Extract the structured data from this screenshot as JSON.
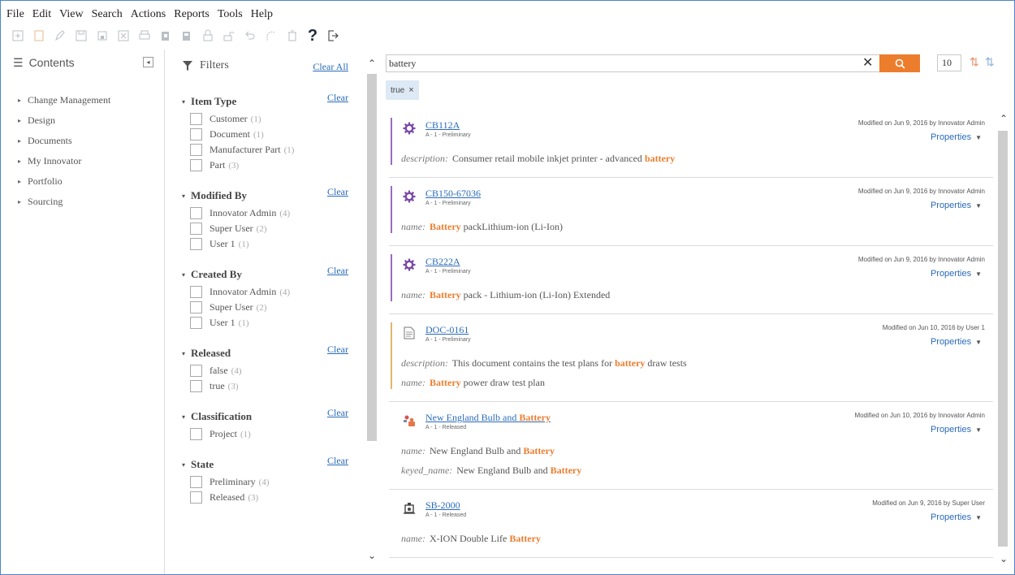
{
  "menu": [
    "File",
    "Edit",
    "View",
    "Search",
    "Actions",
    "Reports",
    "Tools",
    "Help"
  ],
  "toolbar": {
    "icons": [
      "new-icon",
      "open-icon",
      "edit-icon",
      "save-icon",
      "save-close-icon",
      "delete-icon",
      "print-icon",
      "copy-icon",
      "paste-icon",
      "lock-icon",
      "unlock-icon",
      "undo-icon",
      "redo-icon",
      "purge-icon",
      "help-icon",
      "exit-icon"
    ],
    "help_label": "?"
  },
  "contents": {
    "title": "Contents",
    "items": [
      "Change Management",
      "Design",
      "Documents",
      "My Innovator",
      "Portfolio",
      "Sourcing"
    ]
  },
  "filters": {
    "title": "Filters",
    "clear_all": "Clear All",
    "clear": "Clear",
    "groups": [
      {
        "title": "Item Type",
        "options": [
          {
            "label": "Customer",
            "count": "(1)"
          },
          {
            "label": "Document",
            "count": "(1)"
          },
          {
            "label": "Manufacturer Part",
            "count": "(1)"
          },
          {
            "label": "Part",
            "count": "(3)"
          }
        ]
      },
      {
        "title": "Modified By",
        "options": [
          {
            "label": "Innovator Admin",
            "count": "(4)"
          },
          {
            "label": "Super User",
            "count": "(2)"
          },
          {
            "label": "User 1",
            "count": "(1)"
          }
        ]
      },
      {
        "title": "Created By",
        "options": [
          {
            "label": "Innovator Admin",
            "count": "(4)"
          },
          {
            "label": "Super User",
            "count": "(2)"
          },
          {
            "label": "User 1",
            "count": "(1)"
          }
        ]
      },
      {
        "title": "Released",
        "options": [
          {
            "label": "false",
            "count": "(4)"
          },
          {
            "label": "true",
            "count": "(3)"
          }
        ]
      },
      {
        "title": "Classification",
        "options": [
          {
            "label": "Project",
            "count": "(1)"
          }
        ]
      },
      {
        "title": "State",
        "options": [
          {
            "label": "Preliminary",
            "count": "(4)"
          },
          {
            "label": "Released",
            "count": "(3)"
          }
        ]
      }
    ]
  },
  "search": {
    "query": "battery",
    "clear_symbol": "✕",
    "page_size": "10",
    "chip": "true"
  },
  "results": {
    "properties_label": "Properties",
    "items": [
      {
        "name": "CB112A",
        "sub": "A - 1 - Preliminary",
        "modified": "Modified on Jun 9, 2016 by Innovator Admin",
        "bar_color": "#9a6cc0",
        "icon": "gear-icon",
        "fields": [
          {
            "key": "description:",
            "before": " Consumer retail mobile inkjet printer - advanced ",
            "hl": "battery",
            "after": ""
          }
        ]
      },
      {
        "name": "CB150-67036",
        "sub": "A - 1 - Preliminary",
        "modified": "Modified on Jun 9, 2016 by Innovator Admin",
        "bar_color": "#9a6cc0",
        "icon": "gear-icon",
        "fields": [
          {
            "key": "name:",
            "before": " ",
            "hl": "Battery",
            "after": " packLithium-ion (Li-Ion)"
          }
        ]
      },
      {
        "name": "CB222A",
        "sub": "A - 1 - Preliminary",
        "modified": "Modified on Jun 9, 2016 by Innovator Admin",
        "bar_color": "#9a6cc0",
        "icon": "gear-icon",
        "fields": [
          {
            "key": "name:",
            "before": " ",
            "hl": "Battery",
            "after": " pack - Lithium-ion (Li-Ion) Extended"
          }
        ]
      },
      {
        "name": "DOC-0161",
        "sub": "A - 1 - Preliminary",
        "modified": "Modified on Jun 10, 2016 by User 1",
        "bar_color": "#e0b86a",
        "icon": "document-icon",
        "fields": [
          {
            "key": "description:",
            "before": " This document contains the test plans for ",
            "hl": "battery",
            "after": " draw tests"
          },
          {
            "key": "name:",
            "before": " ",
            "hl": "Battery",
            "after": " power draw test plan"
          }
        ]
      },
      {
        "name_before": "New England Bulb and ",
        "name_hl": "Battery",
        "sub": "A - 1 - Released",
        "modified": "Modified on Jun 10, 2016 by Innovator Admin",
        "bar_color": "",
        "icon": "customer-icon",
        "fields": [
          {
            "key": "name:",
            "before": " New England Bulb and ",
            "hl": "Battery",
            "after": ""
          },
          {
            "key": "keyed_name:",
            "before": " New England Bulb and ",
            "hl": "Battery",
            "after": ""
          }
        ]
      },
      {
        "name": "SB-2000",
        "sub": "A - 1 - Released",
        "modified": "Modified on Jun 9, 2016 by Super User",
        "bar_color": "",
        "icon": "manufacturer-part-icon",
        "fields": [
          {
            "key": "name:",
            "before": " X-ION Double Life ",
            "hl": "Battery",
            "after": ""
          }
        ]
      }
    ]
  },
  "colors": {
    "accent": "#ec7d2d",
    "link": "#2a6bb8",
    "frame": "#4a86c8"
  }
}
